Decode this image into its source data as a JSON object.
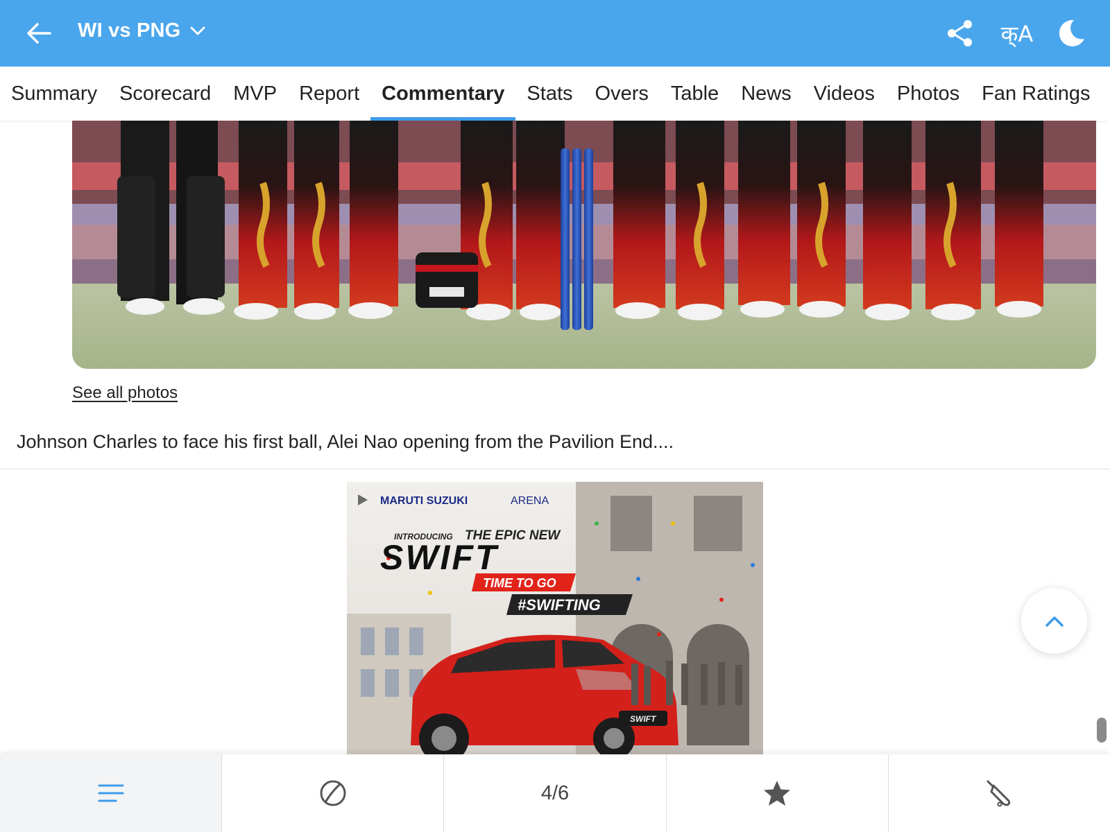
{
  "header": {
    "match_title": "WI vs PNG",
    "lang_label": "क्A",
    "background_color": "#4aa6ec"
  },
  "tabs": [
    {
      "label": "Summary"
    },
    {
      "label": "Scorecard"
    },
    {
      "label": "MVP"
    },
    {
      "label": "Report"
    },
    {
      "label": "Commentary",
      "active": true
    },
    {
      "label": "Stats"
    },
    {
      "label": "Overs"
    },
    {
      "label": "Table"
    },
    {
      "label": "News"
    },
    {
      "label": "Videos"
    },
    {
      "label": "Photos"
    },
    {
      "label": "Fan Ratings"
    }
  ],
  "photo": {
    "see_all_label": "See all photos"
  },
  "commentary": {
    "text": "Johnson Charles to face his first ball, Alei Nao opening from the Pavilion End...."
  },
  "ad": {
    "brand": "MARUTI SUZUKI",
    "brand_suffix": "ARENA",
    "introducing": "INTRODUCING",
    "headline": "THE EPIC NEW",
    "model": "SWIFT",
    "tagline": "TIME TO GO",
    "hashtag": "#SWIFTING",
    "plate": "SWIFT"
  },
  "bottom_bar": {
    "page_indicator": "4/6"
  },
  "icons": {
    "back": "arrow-left-icon",
    "dropdown": "chevron-down-icon",
    "share": "share-icon",
    "language": "language-icon",
    "theme": "moon-icon",
    "scroll_top": "chevron-up-icon",
    "menu": "menu-lines-icon",
    "ball": "cricket-ball-icon",
    "star": "star-icon",
    "bat": "cricket-bat-icon"
  },
  "colors": {
    "accent": "#3d9be9",
    "ad_red": "#e2231a"
  }
}
